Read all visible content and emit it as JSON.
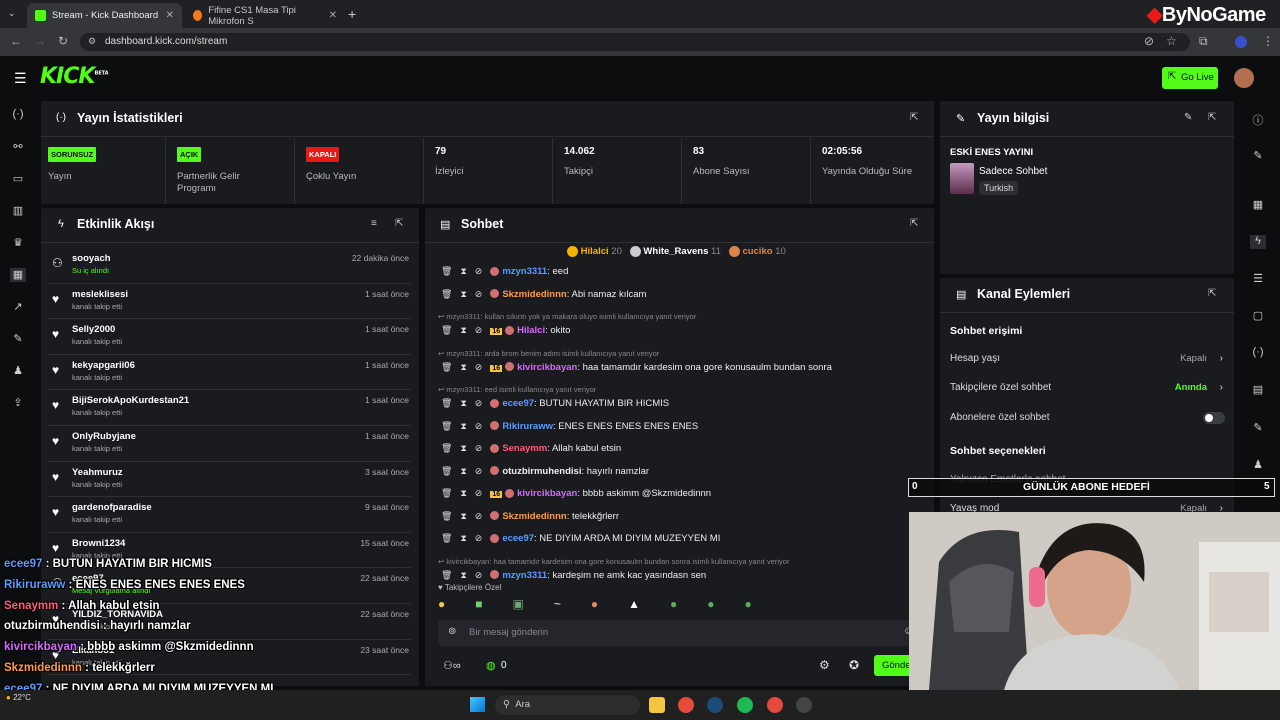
{
  "browser": {
    "tabs": [
      {
        "title": "Stream - Kick Dashboard"
      },
      {
        "title": "Fifine CS1 Masa Tipi Mikrofon S"
      }
    ],
    "url": "dashboard.kick.com/stream"
  },
  "app": {
    "logo": "KICK",
    "logo_sup": "BETA",
    "go_live": "Go Live"
  },
  "stats": {
    "title": "Yayın İstatistikleri",
    "items": [
      {
        "badge": "SORUNSUZ",
        "label": "Yayın",
        "color": "#53fc18"
      },
      {
        "badge": "AÇIK",
        "label": "Partnerlik Gelir Programı",
        "color": "#53fc18"
      },
      {
        "badge": "KAPALI",
        "label": "Çoklu Yayın",
        "color": "#e91916"
      },
      {
        "value": "79",
        "label": "İzleyici"
      },
      {
        "value": "14.062",
        "label": "Takipçi"
      },
      {
        "value": "83",
        "label": "Abone Sayısı"
      },
      {
        "value": "02:05:56",
        "label": "Yayında Olduğu Süre"
      }
    ]
  },
  "stream_info": {
    "title": "Yayın bilgisi",
    "stream_title": "ESKİ ENES YAYINI",
    "category": "Sadece Sohbet",
    "language": "Turkish"
  },
  "activity": {
    "title": "Etkinlik Akışı",
    "items": [
      {
        "name": "sooyach",
        "sub": "Su iç alındı",
        "time": "22 dakika önce",
        "icon": "reward-icon"
      },
      {
        "name": "mesleklisesi",
        "sub": "kanalı takip etti",
        "time": "1 saat önce",
        "icon": "heart-icon"
      },
      {
        "name": "Selly2000",
        "sub": "kanalı takip etti",
        "time": "1 saat önce",
        "icon": "heart-icon"
      },
      {
        "name": "kekyapgarii06",
        "sub": "kanalı takip etti",
        "time": "1 saat önce",
        "icon": "heart-icon"
      },
      {
        "name": "BijiSerokApoKurdestan21",
        "sub": "kanalı takip etti",
        "time": "1 saat önce",
        "icon": "heart-icon"
      },
      {
        "name": "OnlyRubyjane",
        "sub": "kanalı takip etti",
        "time": "1 saat önce",
        "icon": "heart-icon"
      },
      {
        "name": "Yeahmuruz",
        "sub": "kanalı takip etti",
        "time": "3 saat önce",
        "icon": "heart-icon"
      },
      {
        "name": "gardenofparadise",
        "sub": "kanalı takip etti",
        "time": "9 saat önce",
        "icon": "heart-icon"
      },
      {
        "name": "Browni1234",
        "sub": "kanalı takip etti",
        "time": "15 saat önce",
        "icon": "heart-icon"
      },
      {
        "name": "ecee97",
        "sub": "Mesaj Vurgulama alındı",
        "time": "22 saat önce",
        "icon": "reward-icon"
      },
      {
        "name": "YILDIZ_TORNAVIDA",
        "sub": "kanalı takip etti",
        "time": "22 saat önce",
        "icon": "heart-icon"
      },
      {
        "name": "Elkanoo1",
        "sub": "kanalı takip etti",
        "time": "23 saat önce",
        "icon": "heart-icon"
      }
    ]
  },
  "chat": {
    "title": "Sohbet",
    "top": [
      {
        "name": "Hilalci",
        "count": "20"
      },
      {
        "name": "White_Ravens",
        "count": "11"
      },
      {
        "name": "cuciko",
        "count": "10"
      }
    ],
    "messages": [
      {
        "user": "mzyn3311",
        "color": "#5b9bff",
        "text": "eed",
        "age": ""
      },
      {
        "user": "Skzmidedinnn",
        "color": "#ff9b4a",
        "text": "Abi namaz kılcam",
        "age": ""
      },
      {
        "reply": "mzyn3311: kullan sıkıntı yok ya makara oluyo isimli kullanıcıya yanıt veriyor"
      },
      {
        "user": "Hilalci",
        "color": "#d46bff",
        "text": "okito",
        "age": "16"
      },
      {
        "reply": "mzyn3311: arda brom benim adım isimli kullanıcıya yanıt veriyor"
      },
      {
        "user": "kivircikbayan",
        "color": "#d46bff",
        "text": "haa tamamdır kardesim ona gore konusaulm bundan sonra",
        "age": "16"
      },
      {
        "reply": "mzyn3311: eed isimli kullanıcıya yanıt veriyor"
      },
      {
        "user": "ecee97",
        "color": "#5b9bff",
        "text": "BUTUN HAYATIM BIR HICMIS",
        "age": ""
      },
      {
        "user": "Rikiruraww",
        "color": "#5b9bff",
        "text": "ENES ENES ENES ENES ENES",
        "age": ""
      },
      {
        "user": "Senaymm",
        "color": "#ff5b7a",
        "text": "Allah kabul etsin",
        "age": ""
      },
      {
        "user": "otuzbirmuhendisi",
        "color": "#eeeeee",
        "text": "hayırlı namzlar",
        "age": ""
      },
      {
        "user": "kivircikbayan",
        "color": "#d46bff",
        "text": "bbbb askimm @Skzmidedinnn",
        "age": "16"
      },
      {
        "user": "Skzmidedinnn",
        "color": "#ff9b4a",
        "text": "telekkğrlerr",
        "age": ""
      },
      {
        "user": "ecee97",
        "color": "#5b9bff",
        "text": "NE DIYIM ARDA MI DIYIM MUZEYYEN MI",
        "age": ""
      },
      {
        "reply": "kivircikbayan: haa tamamdır kardesim ona gore konusaulm bundan sonra isimli kullanıcıya yanıt veriyor"
      },
      {
        "user": "mzyn3311",
        "color": "#5b9bff",
        "text": "kardeşim ne amk kac yasındasn sen",
        "age": ""
      }
    ],
    "mode": "Takipçilere Özel",
    "placeholder": "Bir mesaj gönderin",
    "points": "0",
    "send": "Gönder"
  },
  "actions": {
    "title": "Kanal Eylemleri",
    "access_title": "Sohbet erişimi",
    "rows": [
      {
        "label": "Hesap yaşı",
        "value": "Kapalı",
        "color": "#aaaaaa"
      },
      {
        "label": "Takipçilere özel sohbet",
        "value": "Anında",
        "color": "#53fc18"
      },
      {
        "label": "Abonelere özel sohbet",
        "value": "",
        "color": "#aaaaaa"
      }
    ],
    "options_title": "Sohbet seçenekleri",
    "options": [
      {
        "label": "Yalnızca Emotlarla sohbet"
      },
      {
        "label": "Yavaş mod",
        "value": "Kapalı"
      }
    ]
  },
  "overlay": {
    "goal": {
      "left": "0",
      "title": "GÜNLÜK ABONE HEDEFİ",
      "right": "5"
    },
    "brand": "ByNoGame",
    "chat": [
      {
        "user": "ecee97",
        "color": "#5b9bff",
        "text": "BUTUN HAYATIM BIR HICMIS"
      },
      {
        "user": "Rikiruraww",
        "color": "#5b9bff",
        "text": "ENES ENES ENES ENES ENES"
      },
      {
        "user": "Senaymm",
        "color": "#ff5b7a",
        "text": "Allah kabul etsin"
      },
      {
        "user": "otuzbirmuhendisi",
        "color": "#ffffff",
        "text": "hayırlı namzlar"
      },
      {
        "user": "kivircikbayan",
        "color": "#d46bff",
        "text": "bbbb askimm @Skzmidedinnn"
      },
      {
        "user": "Skzmidedinnn",
        "color": "#ff9b4a",
        "text": "telekkğrlerr"
      },
      {
        "user": "ecee97",
        "color": "#5b9bff",
        "text": "NE DIYIM ARDA MI DIYIM MUZEYYEN MI"
      },
      {
        "user": "mzyn3311",
        "color": "#5b9bff",
        "text": "kardeşim ne amk kac yasındasn sen"
      }
    ]
  },
  "taskbar": {
    "search": "Ara",
    "temp": "22°C"
  }
}
